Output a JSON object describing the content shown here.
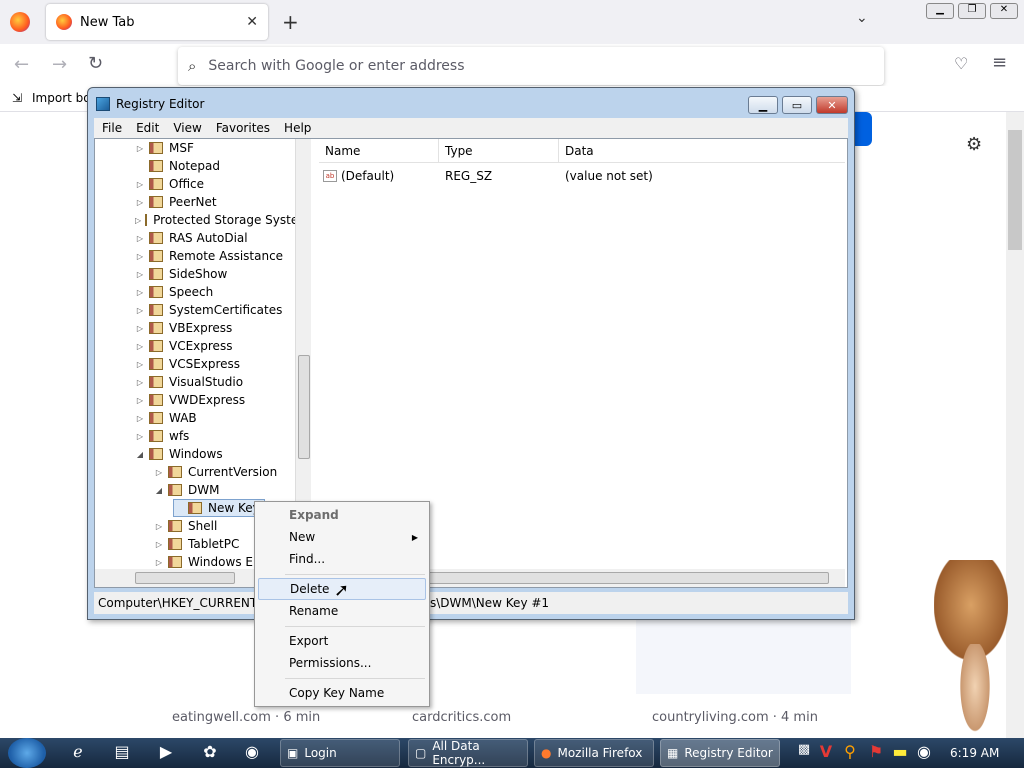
{
  "browser": {
    "tab_title": "New Tab",
    "url_placeholder": "Search with Google or enter address",
    "bookmark_label": "Import bo"
  },
  "regedit": {
    "title": "Registry Editor",
    "menu": [
      "File",
      "Edit",
      "View",
      "Favorites",
      "Help"
    ],
    "tree": [
      {
        "label": "MSF",
        "toggle": "▷"
      },
      {
        "label": "Notepad",
        "toggle": ""
      },
      {
        "label": "Office",
        "toggle": "▷"
      },
      {
        "label": "PeerNet",
        "toggle": "▷"
      },
      {
        "label": "Protected Storage Syste",
        "toggle": "▷"
      },
      {
        "label": "RAS AutoDial",
        "toggle": "▷"
      },
      {
        "label": "Remote Assistance",
        "toggle": "▷"
      },
      {
        "label": "SideShow",
        "toggle": "▷"
      },
      {
        "label": "Speech",
        "toggle": "▷"
      },
      {
        "label": "SystemCertificates",
        "toggle": "▷"
      },
      {
        "label": "VBExpress",
        "toggle": "▷"
      },
      {
        "label": "VCExpress",
        "toggle": "▷"
      },
      {
        "label": "VCSExpress",
        "toggle": "▷"
      },
      {
        "label": "VisualStudio",
        "toggle": "▷"
      },
      {
        "label": "VWDExpress",
        "toggle": "▷"
      },
      {
        "label": "WAB",
        "toggle": "▷"
      },
      {
        "label": "wfs",
        "toggle": "▷"
      },
      {
        "label": "Windows",
        "toggle": "◢"
      },
      {
        "label": "CurrentVersion",
        "toggle": "▷"
      },
      {
        "label": "DWM",
        "toggle": "◢"
      },
      {
        "label": "New Key",
        "toggle": ""
      },
      {
        "label": "Shell",
        "toggle": "▷"
      },
      {
        "label": "TabletPC",
        "toggle": "▷"
      },
      {
        "label": "Windows Er",
        "toggle": "▷"
      }
    ],
    "columns": {
      "name": "Name",
      "type": "Type",
      "data": "Data"
    },
    "values": [
      {
        "name": "(Default)",
        "type": "REG_SZ",
        "data": "(value not set)"
      }
    ],
    "status_left": "Computer\\HKEY_CURRENT_U",
    "status_right": "s\\DWM\\New Key #1"
  },
  "context_menu": {
    "expand": "Expand",
    "new": "New",
    "find": "Find...",
    "delete": "Delete",
    "rename": "Rename",
    "export": "Export",
    "permissions": "Permissions...",
    "copy_key_name": "Copy Key Name"
  },
  "page_cards": [
    {
      "source": "eatingwell.com · 6 min"
    },
    {
      "source": "cardcritics.com"
    },
    {
      "source": "countryliving.com · 4 min"
    }
  ],
  "taskbar": {
    "tasks": [
      "Login",
      "All Data Encryp...",
      "Mozilla Firefox",
      "Registry Editor"
    ],
    "clock": "6:19 AM"
  }
}
